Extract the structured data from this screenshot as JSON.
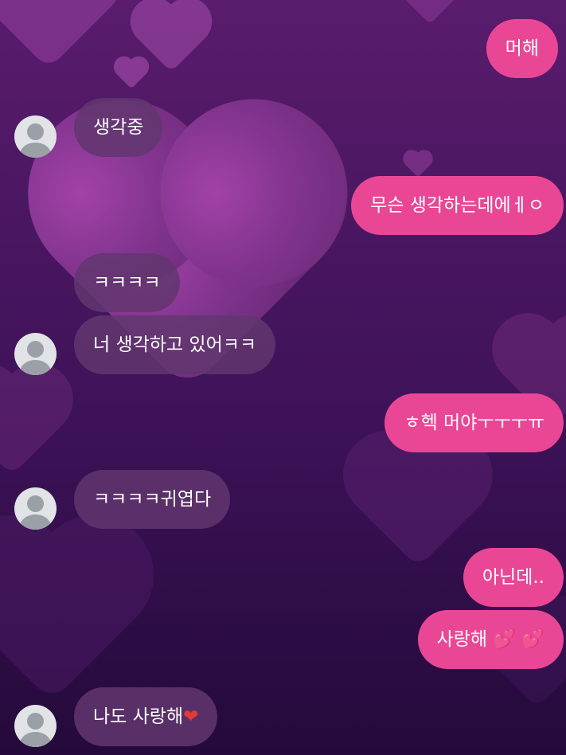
{
  "theme": {
    "sent_bubble_color": "#e94796",
    "received_bubble_color": "#62366e",
    "background_top": "#5a1c6d",
    "background_bottom": "#240a3a"
  },
  "messages": [
    {
      "side": "sent",
      "text": "머해"
    },
    {
      "side": "received",
      "text": "생각중",
      "avatar": "default-avatar-icon"
    },
    {
      "side": "sent",
      "text": "무슨 생각하는데에ㅔㅇ"
    },
    {
      "side": "received",
      "text": "ㅋㅋㅋㅋ"
    },
    {
      "side": "received",
      "text": "너 생각하고 있어ㅋㅋ",
      "avatar": "default-avatar-icon"
    },
    {
      "side": "sent",
      "text": "ㅎ헥 머야ㅜㅜㅜㅠ"
    },
    {
      "side": "received",
      "text": "ㅋㅋㅋㅋ귀엽다",
      "avatar": "default-avatar-icon"
    },
    {
      "side": "sent",
      "text": "아닌데.."
    },
    {
      "side": "sent",
      "text": "사랑해",
      "emoji": "💕 💕",
      "emoji_name": "two-hearts-icon"
    },
    {
      "side": "received",
      "text": "나도 사랑해",
      "emoji": "❤",
      "emoji_name": "red-heart-icon",
      "avatar": "default-avatar-icon"
    }
  ]
}
